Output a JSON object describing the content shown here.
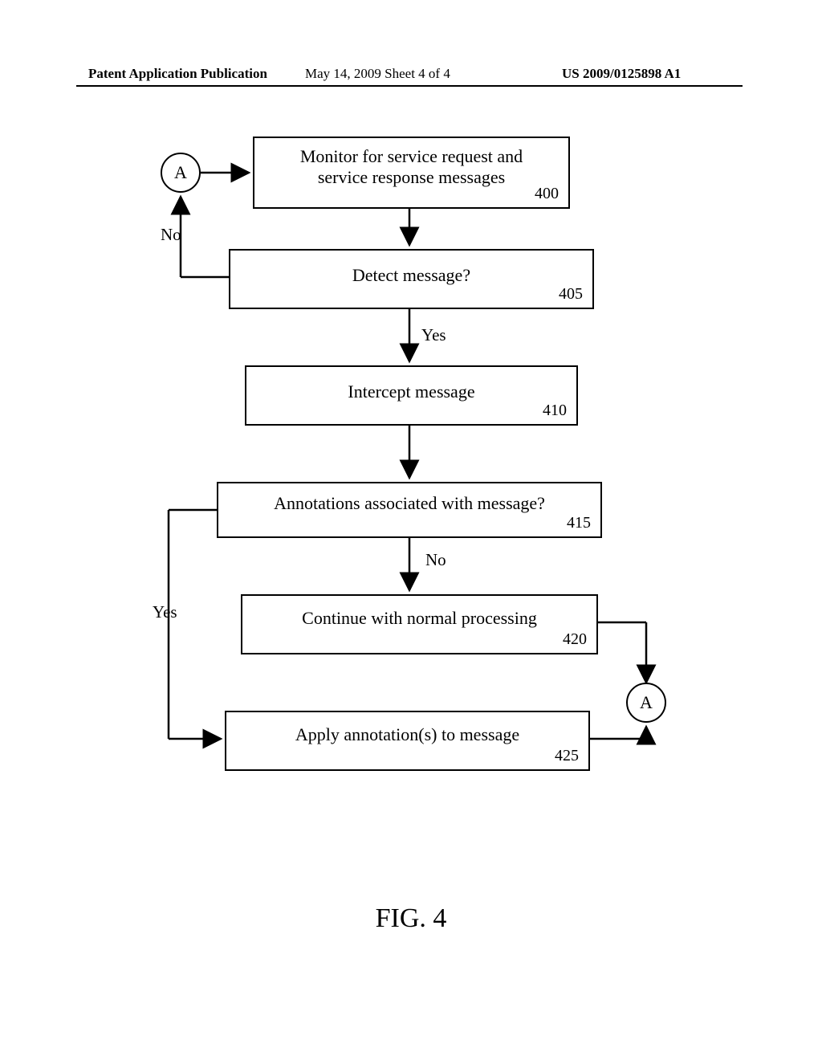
{
  "header": {
    "left": "Patent Application Publication",
    "center": "May 14, 2009  Sheet 4 of 4",
    "right": "US 2009/0125898 A1"
  },
  "connector_a": "A",
  "boxes": {
    "b400": {
      "text": "Monitor for service request and\nservice response messages",
      "num": "400"
    },
    "b405": {
      "text": "Detect message?",
      "num": "405"
    },
    "b410": {
      "text": "Intercept message",
      "num": "410"
    },
    "b415": {
      "text": "Annotations associated with message?",
      "num": "415"
    },
    "b420": {
      "text": "Continue with normal processing",
      "num": "420"
    },
    "b425": {
      "text": "Apply annotation(s) to message",
      "num": "425"
    }
  },
  "labels": {
    "no_405": "No",
    "yes_405": "Yes",
    "no_415": "No",
    "yes_415": "Yes"
  },
  "figure": "FIG. 4"
}
